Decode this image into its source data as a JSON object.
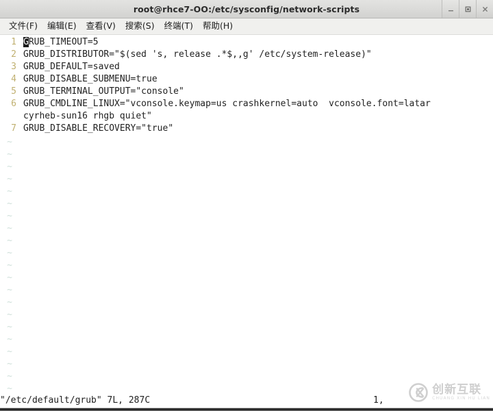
{
  "window": {
    "title": "root@rhce7-OO:/etc/sysconfig/network-scripts",
    "controls": [
      {
        "name": "minimize",
        "glyph": "minimize-icon"
      },
      {
        "name": "maximize",
        "glyph": "maximize-icon"
      },
      {
        "name": "close",
        "glyph": "close-icon"
      }
    ]
  },
  "menubar": {
    "items": [
      {
        "label": "文件(F)"
      },
      {
        "label": "编辑(E)"
      },
      {
        "label": "查看(V)"
      },
      {
        "label": "搜索(S)"
      },
      {
        "label": "终端(T)"
      },
      {
        "label": "帮助(H)"
      }
    ]
  },
  "editor": {
    "cursor_char": "G",
    "lines": [
      {
        "num": "1",
        "text": "RUB_TIMEOUT=5",
        "cursor": true
      },
      {
        "num": "2",
        "text": "GRUB_DISTRIBUTOR=\"$(sed 's, release .*$,,g' /etc/system-release)\"",
        "cursor": false
      },
      {
        "num": "3",
        "text": "GRUB_DEFAULT=saved",
        "cursor": false
      },
      {
        "num": "4",
        "text": "GRUB_DISABLE_SUBMENU=true",
        "cursor": false
      },
      {
        "num": "5",
        "text": "GRUB_TERMINAL_OUTPUT=\"console\"",
        "cursor": false
      },
      {
        "num": "6",
        "text": "GRUB_CMDLINE_LINUX=\"vconsole.keymap=us crashkernel=auto  vconsole.font=latar",
        "cursor": false
      },
      {
        "num": "",
        "text": "cyrheb-sun16 rhgb quiet\"",
        "cursor": false
      },
      {
        "num": "7",
        "text": "GRUB_DISABLE_RECOVERY=\"true\"",
        "cursor": false
      }
    ],
    "empty_marker": "~",
    "empty_marker_count": 22
  },
  "statusline": {
    "file_info": "\"/etc/default/grub\" 7L, 287C",
    "position": "1,"
  },
  "watermark": {
    "chinese": "创新互联",
    "pinyin": "CHUANG XIN HU LIAN"
  },
  "colors": {
    "titlebar": "#dcdcda",
    "menubar": "#f0f0ee",
    "terminal_bg": "#ffffff",
    "terminal_fg": "#222222",
    "line_number": "#c0b070",
    "tilde": "#cfe0da",
    "cursor_bg": "#1a1a1a"
  }
}
